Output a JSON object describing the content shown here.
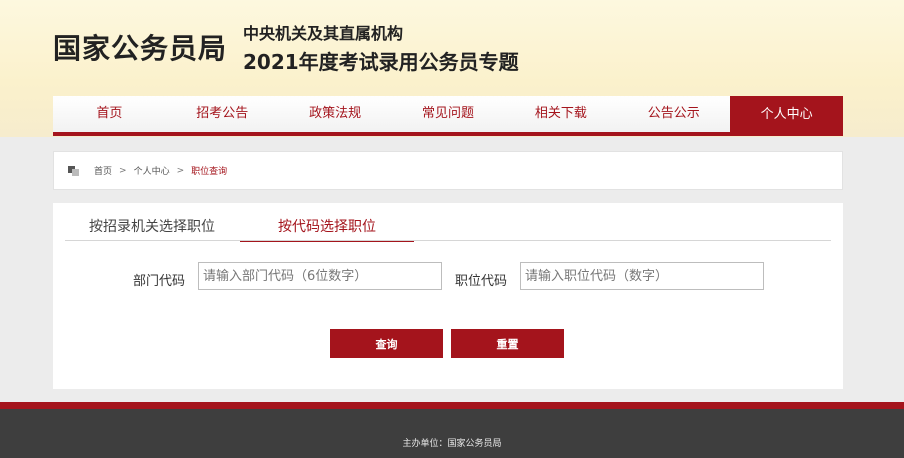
{
  "header": {
    "logo": "国家公务员局",
    "subtitle_line1": "中央机关及其直属机构",
    "subtitle_line2": "2021年度考试录用公务员专题"
  },
  "nav": {
    "items": [
      {
        "label": "首页"
      },
      {
        "label": "招考公告"
      },
      {
        "label": "政策法规"
      },
      {
        "label": "常见问题"
      },
      {
        "label": "相关下载"
      },
      {
        "label": "公告公示"
      },
      {
        "label": "个人中心"
      }
    ],
    "active_index": 6
  },
  "breadcrumb": {
    "icon": "home-icon",
    "items": [
      "首页",
      "个人中心",
      "职位查询"
    ],
    "separator": ">"
  },
  "tabs": [
    {
      "label": "按招录机关选择职位"
    },
    {
      "label": "按代码选择职位"
    }
  ],
  "form": {
    "dept_label": "部门代码",
    "dept_placeholder": "请输入部门代码（6位数字）",
    "pos_label": "职位代码",
    "pos_placeholder": "请输入职位代码（数字）",
    "query_label": "查询",
    "reset_label": "重置"
  },
  "footer": {
    "text": "主办单位：国家公务员局"
  },
  "colors": {
    "accent": "#a4141c",
    "header_bg": "#fbf1cc",
    "footer_bg": "#3e3e3e"
  }
}
